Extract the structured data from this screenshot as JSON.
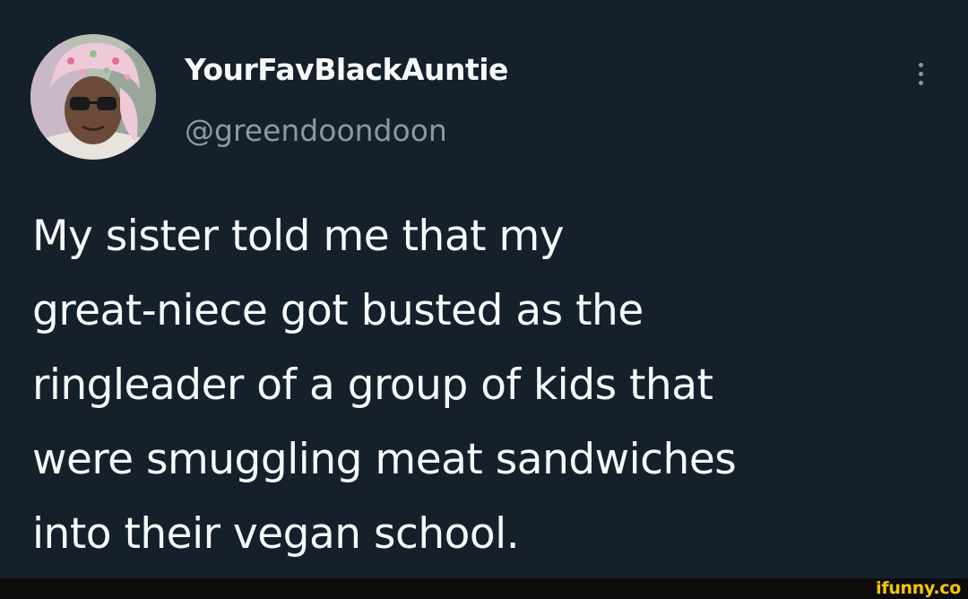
{
  "tweet": {
    "author": {
      "display_name": "YourFavBlackAuntie",
      "handle": "@greendoondoon",
      "avatar_icon": "profile-photo-avatar"
    },
    "more_icon": "more-options-icon",
    "text_lines": [
      "My sister told me that my",
      "great-niece got busted as the",
      "ringleader of a group of kids that",
      "were smuggling meat sandwiches",
      "into their vegan school."
    ]
  },
  "watermark": {
    "text": "ifunny.co"
  },
  "colors": {
    "background": "#15202b",
    "primary_text": "#f7f9f9",
    "secondary_text": "#8b98a5",
    "watermark": "#f5c600"
  }
}
